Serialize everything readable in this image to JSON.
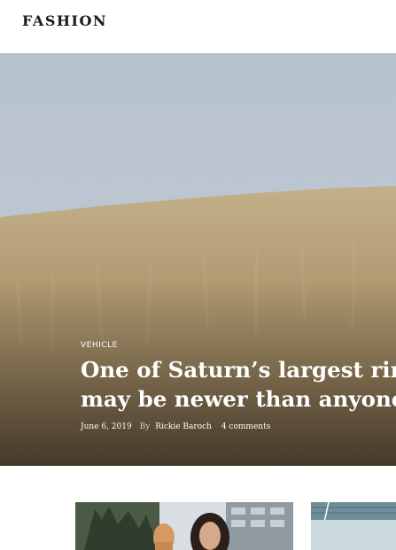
{
  "site": {
    "logo": "FASHION"
  },
  "hero": {
    "category": "VEHICLE",
    "title_line1": "One of Saturn’s largest rings",
    "title_line2": "may be newer than anyone",
    "date": "June 6, 2019",
    "by": "By",
    "author": "Rickie Baroch",
    "comments": "4 comments"
  }
}
